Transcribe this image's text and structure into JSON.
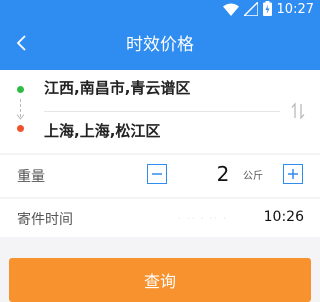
{
  "status_bar": {
    "time": "10:27",
    "icons": [
      "wifi-icon",
      "signal-icon",
      "battery-charging-icon"
    ],
    "color": "#2f8cf0"
  },
  "header": {
    "title": "时效价格",
    "back_icon": "chevron-left-icon",
    "color": "#2f8cf0"
  },
  "route": {
    "from_address": "江西,南昌市,青云谱区",
    "to_address": "上海,上海,松江区",
    "from_color": "#2ebd42",
    "to_color": "#f0522c",
    "swap_icon": "swap-vertical-icon"
  },
  "weight": {
    "label": "重量",
    "value": "2",
    "unit": "公斤",
    "minus_icon": "minus-icon",
    "plus_icon": "plus-icon"
  },
  "send_time": {
    "label": "寄件时间",
    "value": "10:26"
  },
  "query_button": {
    "label": "查询",
    "color": "#f7922e"
  }
}
